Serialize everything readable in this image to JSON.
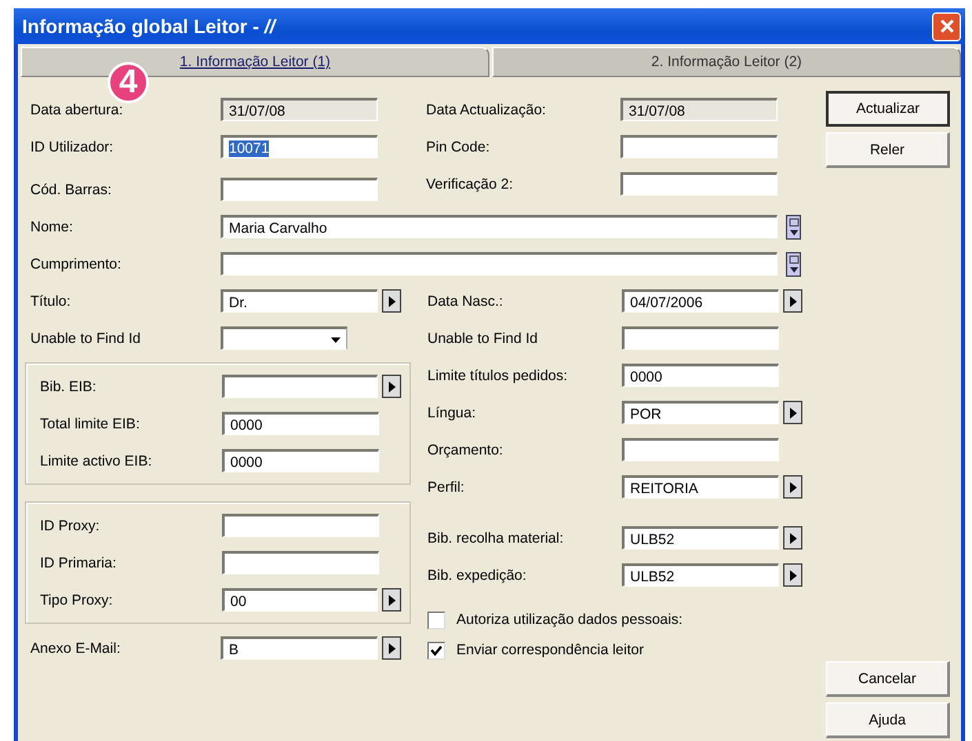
{
  "window": {
    "title": "Informação global Leitor - *//*"
  },
  "tabs": [
    {
      "label": "1. Informação Leitor (1)",
      "selected": true
    },
    {
      "label": "2. Informação Leitor (2)",
      "selected": false
    }
  ],
  "badge": "4",
  "top_left": [
    {
      "label": "Data abertura:",
      "kind": "readonly",
      "value": "31/07/08"
    },
    {
      "label": "ID Utilizador:",
      "kind": "text",
      "value": "10071",
      "text_selected": true
    },
    {
      "label": "Cód. Barras:",
      "kind": "text"
    }
  ],
  "top_right": [
    {
      "label": "Data Actualização:",
      "kind": "readonly",
      "value": "31/07/08"
    },
    {
      "label": "Pin Code:",
      "kind": "text"
    },
    {
      "label": "Verificação 2:",
      "kind": "text"
    }
  ],
  "wide": [
    {
      "label": "Nome:",
      "kind": "memo",
      "value": "Maria Carvalho"
    },
    {
      "label": "Cumprimento:",
      "kind": "memo"
    }
  ],
  "left": [
    {
      "label": "Título:",
      "kind": "select",
      "value": "Dr."
    },
    {
      "label": "Unable to Find Id",
      "kind": "dropdown"
    },
    {
      "kind": "group",
      "fields": [
        {
          "label": "Bib. EIB:",
          "kind": "select"
        },
        {
          "label": "Total limite EIB:",
          "kind": "text",
          "value": "0000"
        },
        {
          "label": "Limite activo EIB:",
          "kind": "text",
          "value": "0000"
        }
      ]
    },
    {
      "kind": "group",
      "fields": [
        {
          "label": "ID Proxy:",
          "kind": "text"
        },
        {
          "label": "ID Primaria:",
          "kind": "text"
        },
        {
          "label": "Tipo Proxy:",
          "kind": "select",
          "value": "00"
        }
      ]
    },
    {
      "label": "Anexo E-Mail:",
      "kind": "select",
      "value": "B"
    }
  ],
  "right": [
    {
      "label": "Data Nasc.:",
      "kind": "select",
      "value": "04/07/2006"
    },
    {
      "label": "Unable to Find Id",
      "kind": "text"
    },
    {
      "label": "Limite títulos pedidos:",
      "kind": "text",
      "value": "0000"
    },
    {
      "label": "Língua:",
      "kind": "select",
      "value": "POR"
    },
    {
      "label": "Orçamento:",
      "kind": "text"
    },
    {
      "label": "Perfil:",
      "kind": "select",
      "value": "REITORIA"
    },
    {
      "label": "Bib. recolha material:",
      "kind": "select",
      "value": "ULB52"
    },
    {
      "label": "Bib. expedição:",
      "kind": "select",
      "value": "ULB52"
    },
    {
      "label": "Autoriza utilização dados pessoais:",
      "kind": "checkbox",
      "checked": false
    },
    {
      "label": "Enviar correspondência leitor",
      "kind": "checkbox",
      "checked": true
    }
  ],
  "buttons_top": [
    {
      "label": "Actualizar",
      "default": true
    },
    {
      "label": "Reler",
      "default": false
    }
  ],
  "buttons_bottom": [
    {
      "label": "Cancelar",
      "default": false
    },
    {
      "label": "Ajuda",
      "default": false
    }
  ]
}
